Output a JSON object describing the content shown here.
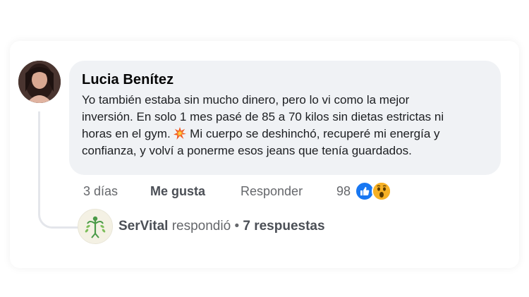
{
  "comment": {
    "author": "Lucia Benítez",
    "text_line1": "Yo también estaba sin mucho dinero, pero lo vi como la mejor",
    "text_line2": "inversión. En solo 1 mes pasé de 85 a 70 kilos sin dietas estrictas ni",
    "text_line3a": "horas en el gym.",
    "text_line3b": "Mi cuerpo se deshinchó, recuperé mi energía y",
    "text_line4": "confianza, y volví a ponerme esos jeans que tenía guardados.",
    "emoji": "collision-icon"
  },
  "actions": {
    "time": "3 días",
    "like": "Me gusta",
    "reply": "Responder",
    "reaction_count": "98",
    "reactions": [
      "like-icon",
      "wow-icon"
    ]
  },
  "reply_summary": {
    "author": "SerVital",
    "verb": "respondió",
    "separator": "•",
    "replies": "7 respuestas"
  },
  "colors": {
    "bubble": "#f0f2f5",
    "like_blue": "#1877f2",
    "wow_yellow": "#f7b125",
    "muted_text": "#65676b"
  }
}
